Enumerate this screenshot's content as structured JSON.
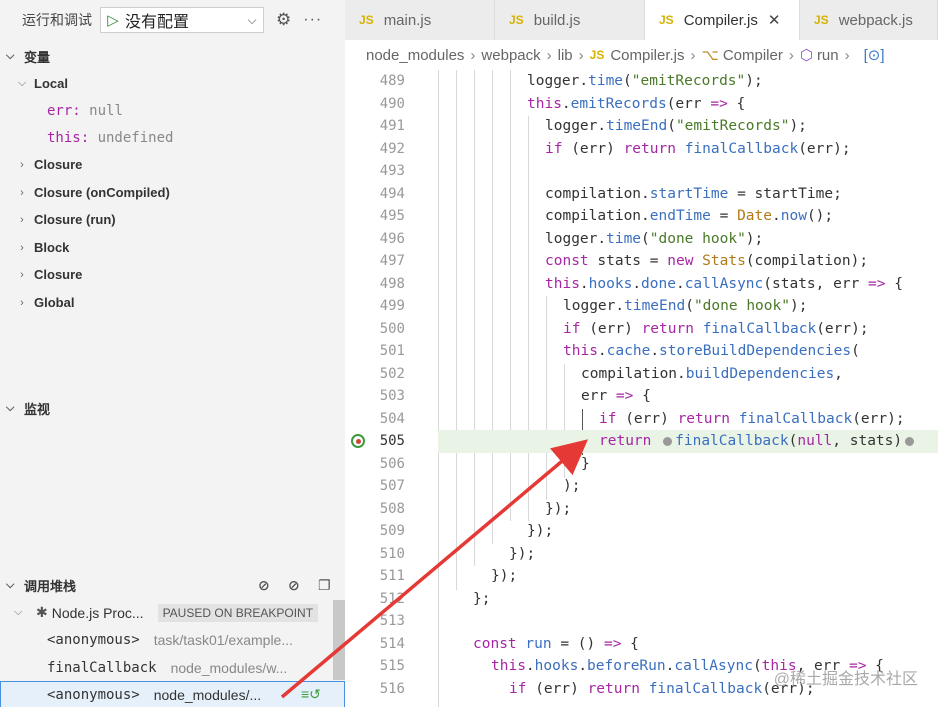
{
  "debug": {
    "title": "运行和调试",
    "config": "没有配置",
    "variables_header": "变量",
    "scopes": [
      {
        "label": "Local",
        "expanded": true
      },
      {
        "label": "Closure"
      },
      {
        "label": "Closure (onCompiled)"
      },
      {
        "label": "Closure (run)"
      },
      {
        "label": "Block"
      },
      {
        "label": "Closure"
      },
      {
        "label": "Global"
      }
    ],
    "locals": [
      {
        "name": "err",
        "value": "null"
      },
      {
        "name": "this",
        "value": "undefined"
      }
    ],
    "watch_header": "监视",
    "callstack_header": "调用堆栈",
    "thread": "Node.js Proc...",
    "paused_badge": "PAUSED ON BREAKPOINT",
    "frames": [
      {
        "fn": "<anonymous>",
        "path": "task/task01/example..."
      },
      {
        "fn": "finalCallback",
        "path": "node_modules/w..."
      },
      {
        "fn": "<anonymous>",
        "path": "node_modules/..."
      }
    ]
  },
  "tabs": [
    {
      "label": "main.js",
      "icon": "JS"
    },
    {
      "label": "build.js",
      "icon": "JS"
    },
    {
      "label": "Compiler.js",
      "icon": "JS",
      "active": true
    },
    {
      "label": "webpack.js",
      "icon": "JS"
    }
  ],
  "breadcrumb": [
    "node_modules",
    "webpack",
    "lib",
    "Compiler.js",
    "Compiler",
    "run"
  ],
  "code_lines": [
    489,
    490,
    491,
    492,
    493,
    494,
    495,
    496,
    497,
    498,
    499,
    500,
    501,
    502,
    503,
    504,
    505,
    506,
    507,
    508,
    509,
    510,
    511,
    512,
    513,
    514,
    515,
    516
  ],
  "breakpoint_line": 505,
  "watermark": "@稀土掘金技术社区",
  "colors": {
    "accent": "#4a90e2",
    "breakpoint": "#c43",
    "arrow": "#e53935"
  }
}
